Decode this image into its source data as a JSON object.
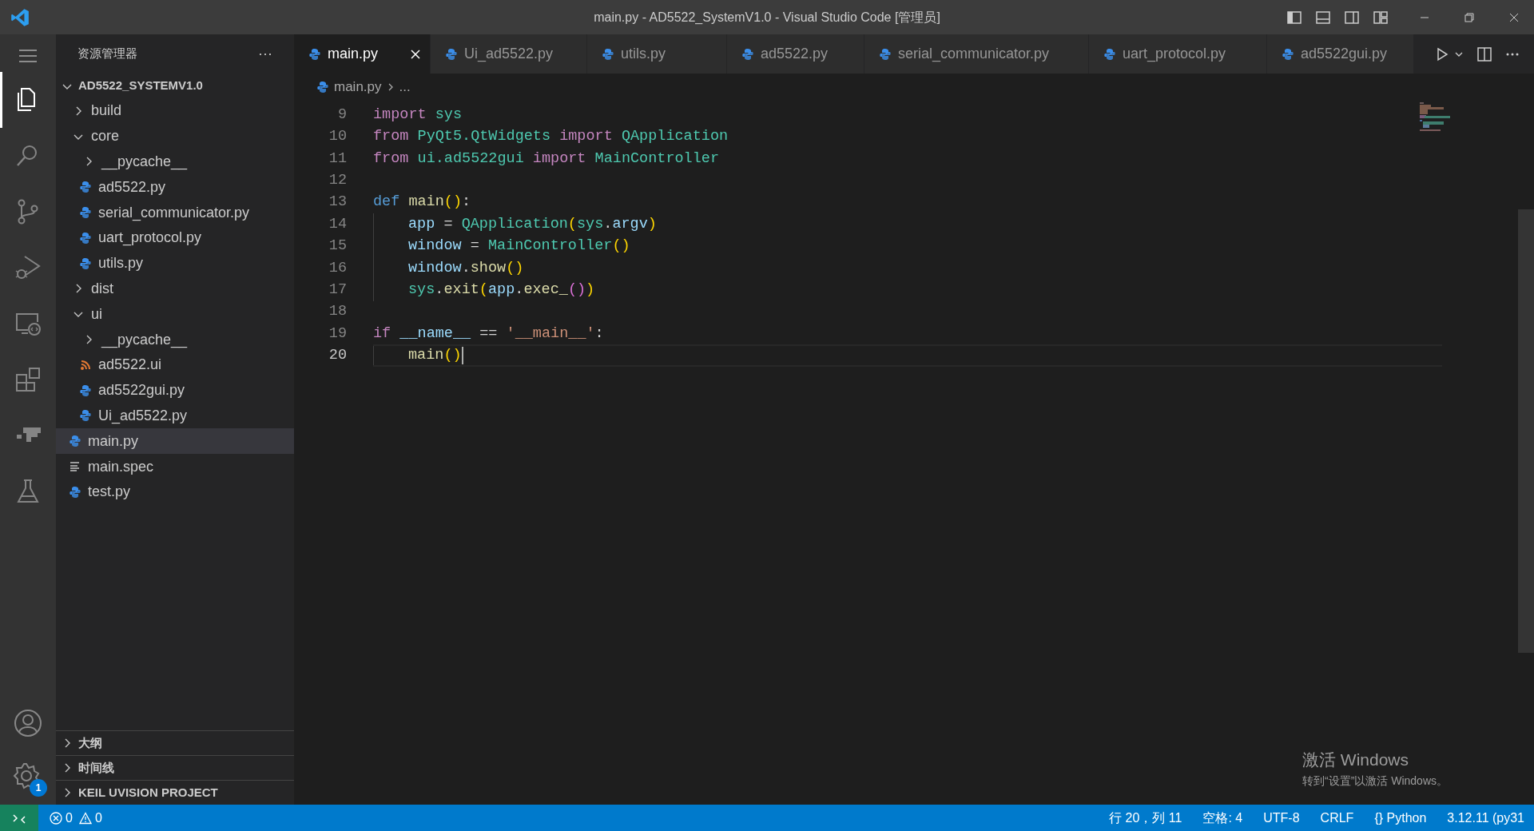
{
  "window": {
    "title": "main.py - AD5522_SystemV1.0 - Visual Studio Code [管理员]"
  },
  "activity_bar": {
    "items": [
      {
        "kind": "files",
        "selected": true
      },
      {
        "kind": "search",
        "selected": false
      },
      {
        "kind": "scm",
        "selected": false
      },
      {
        "kind": "debug",
        "selected": false
      },
      {
        "kind": "remote",
        "selected": false
      },
      {
        "kind": "extensions",
        "selected": false
      },
      {
        "kind": "docker",
        "selected": false
      },
      {
        "kind": "testing",
        "selected": false
      }
    ],
    "settings_badge": "1"
  },
  "sidebar": {
    "title": "资源管理器",
    "more": "···",
    "tree": {
      "label": "AD5522_SYSTEMV1.0",
      "expanded": true,
      "children": [
        {
          "label": "build",
          "kind": "folder",
          "expanded": false,
          "selected": false
        },
        {
          "label": "core",
          "kind": "folder",
          "expanded": true,
          "selected": false,
          "children": [
            {
              "label": "__pycache__",
              "kind": "folder",
              "expanded": false,
              "selected": false
            },
            {
              "label": "ad5522.py",
              "kind": "python",
              "selected": false
            },
            {
              "label": "serial_communicator.py",
              "kind": "python",
              "selected": false
            },
            {
              "label": "uart_protocol.py",
              "kind": "python",
              "selected": false
            },
            {
              "label": "utils.py",
              "kind": "python",
              "selected": false
            }
          ]
        },
        {
          "label": "dist",
          "kind": "folder",
          "expanded": false,
          "selected": false
        },
        {
          "label": "ui",
          "kind": "folder",
          "expanded": true,
          "selected": false,
          "children": [
            {
              "label": "__pycache__",
              "kind": "folder",
              "expanded": false,
              "selected": false
            },
            {
              "label": "ad5522.ui",
              "kind": "ui",
              "selected": false
            },
            {
              "label": "ad5522gui.py",
              "kind": "python",
              "selected": false
            },
            {
              "label": "Ui_ad5522.py",
              "kind": "python",
              "selected": false
            }
          ]
        },
        {
          "label": "main.py",
          "kind": "python",
          "selected": true
        },
        {
          "label": "main.spec",
          "kind": "text",
          "selected": false
        },
        {
          "label": "test.py",
          "kind": "python",
          "selected": false
        }
      ]
    },
    "panels": [
      {
        "label": "大纲",
        "expanded": false
      },
      {
        "label": "时间线",
        "expanded": false
      },
      {
        "label": "KEIL UVISION PROJECT",
        "expanded": false
      }
    ]
  },
  "tabs": [
    {
      "label": "main.py",
      "selected": true
    },
    {
      "label": "Ui_ad5522.py",
      "selected": false
    },
    {
      "label": "utils.py",
      "selected": false
    },
    {
      "label": "ad5522.py",
      "selected": false
    },
    {
      "label": "serial_communicator.py",
      "selected": false
    },
    {
      "label": "uart_protocol.py",
      "selected": false
    },
    {
      "label": "ad5522gui.py",
      "selected": false
    }
  ],
  "breadcrumb": {
    "file": "main.py",
    "rest": "..."
  },
  "editor": {
    "lines": [
      {
        "number": "9",
        "current": false,
        "indent": false,
        "tokens": [
          {
            "t": "import",
            "kind": "keyword"
          },
          {
            "t": " sys",
            "kind": "class"
          }
        ]
      },
      {
        "number": "10",
        "current": false,
        "indent": false,
        "tokens": [
          {
            "t": "from",
            "kind": "keyword"
          },
          {
            "t": " PyQt5.QtWidgets",
            "kind": "class"
          },
          {
            "t": " import",
            "kind": "keyword"
          },
          {
            "t": " QApplication",
            "kind": "class"
          }
        ]
      },
      {
        "number": "11",
        "current": false,
        "indent": false,
        "tokens": [
          {
            "t": "from",
            "kind": "keyword"
          },
          {
            "t": " ui.ad5522gui",
            "kind": "class"
          },
          {
            "t": " import",
            "kind": "keyword"
          },
          {
            "t": " MainController",
            "kind": "class"
          }
        ]
      },
      {
        "number": "12",
        "current": false,
        "indent": false
      },
      {
        "number": "13",
        "current": false,
        "indent": false,
        "tokens": [
          {
            "t": "def",
            "kind": "storage"
          },
          {
            "t": " main",
            "kind": "function"
          },
          {
            "t": "()",
            "kind": "bracket"
          },
          {
            "t": ":",
            "kind": "plain"
          }
        ]
      },
      {
        "number": "14",
        "current": false,
        "indent": true,
        "tokens": [
          {
            "t": "app",
            "kind": "variable"
          },
          {
            "t": " = ",
            "kind": "plain"
          },
          {
            "t": "QApplication",
            "kind": "class"
          },
          {
            "t": "(",
            "kind": "bracket"
          },
          {
            "t": "sys",
            "kind": "class"
          },
          {
            "t": ".",
            "kind": "plain"
          },
          {
            "t": "argv",
            "kind": "variable"
          },
          {
            "t": ")",
            "kind": "bracket"
          }
        ]
      },
      {
        "number": "15",
        "current": false,
        "indent": true,
        "tokens": [
          {
            "t": "window",
            "kind": "variable"
          },
          {
            "t": " = ",
            "kind": "plain"
          },
          {
            "t": "MainController",
            "kind": "class"
          },
          {
            "t": "()",
            "kind": "bracket"
          }
        ]
      },
      {
        "number": "16",
        "current": false,
        "indent": true,
        "tokens": [
          {
            "t": "window",
            "kind": "variable"
          },
          {
            "t": ".",
            "kind": "plain"
          },
          {
            "t": "show",
            "kind": "function"
          },
          {
            "t": "()",
            "kind": "bracket"
          }
        ]
      },
      {
        "number": "17",
        "current": false,
        "indent": true,
        "tokens": [
          {
            "t": "sys",
            "kind": "class"
          },
          {
            "t": ".",
            "kind": "plain"
          },
          {
            "t": "exit",
            "kind": "function"
          },
          {
            "t": "(",
            "kind": "bracket"
          },
          {
            "t": "app",
            "kind": "variable"
          },
          {
            "t": ".",
            "kind": "plain"
          },
          {
            "t": "exec_",
            "kind": "function"
          },
          {
            "t": "()",
            "kind": "bracket2"
          },
          {
            "t": ")",
            "kind": "bracket"
          }
        ]
      },
      {
        "number": "18",
        "current": false,
        "indent": false
      },
      {
        "number": "19",
        "current": false,
        "indent": false,
        "tokens": [
          {
            "t": "if",
            "kind": "keyword"
          },
          {
            "t": " __name__",
            "kind": "variable"
          },
          {
            "t": " == ",
            "kind": "plain"
          },
          {
            "t": "'__main__'",
            "kind": "string"
          },
          {
            "t": ":",
            "kind": "plain"
          }
        ]
      },
      {
        "number": "20",
        "current": true,
        "indent": true,
        "tokens": [
          {
            "t": "main",
            "kind": "function"
          },
          {
            "t": "()",
            "kind": "bracket"
          }
        ]
      }
    ]
  },
  "activation_notice": {
    "title": "激活 Windows",
    "subtitle": "转到“设置”以激活 Windows。"
  },
  "status_bar": {
    "errors": "0",
    "warnings": "0",
    "right": [
      "行 20，列 11",
      "空格: 4",
      "UTF-8",
      "CRLF",
      "{} Python",
      "3.12.11 (py31"
    ]
  }
}
